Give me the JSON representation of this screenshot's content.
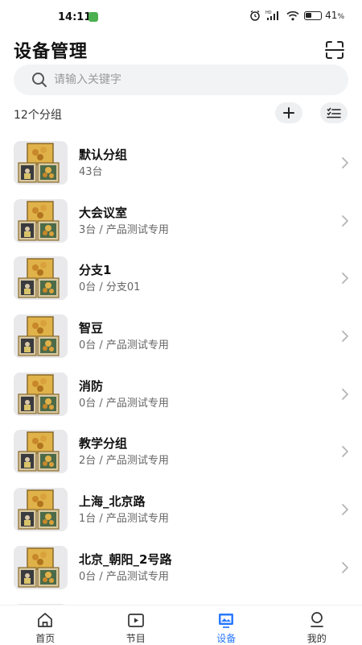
{
  "status_bar": {
    "time": "14:11",
    "battery_text": "41",
    "battery_unit": "%",
    "battery_level": 0.41,
    "network_label": "HD"
  },
  "header": {
    "title": "设备管理",
    "scan_icon": "scan-icon"
  },
  "search": {
    "placeholder": "请输入关键字",
    "value": ""
  },
  "groups_bar": {
    "count_text": "12个分组",
    "add_icon": "plus-icon",
    "sort_icon": "list-check-icon"
  },
  "groups": [
    {
      "name": "默认分组",
      "subtitle": "43台"
    },
    {
      "name": "大会议室",
      "subtitle": "3台 / 产品测试专用"
    },
    {
      "name": "分支1",
      "subtitle": "0台 / 分支01"
    },
    {
      "name": "智豆",
      "subtitle": "0台 / 产品测试专用"
    },
    {
      "name": "消防",
      "subtitle": "0台 / 产品测试专用"
    },
    {
      "name": "教学分组",
      "subtitle": "2台 / 产品测试专用"
    },
    {
      "name": "上海_北京路",
      "subtitle": "1台 / 产品测试专用"
    },
    {
      "name": "北京_朝阳_2号路",
      "subtitle": "0台 / 产品测试专用"
    }
  ],
  "bottom_nav": [
    {
      "label": "首页",
      "icon": "home-icon",
      "active": false
    },
    {
      "label": "节目",
      "icon": "play-icon",
      "active": false
    },
    {
      "label": "设备",
      "icon": "device-icon",
      "active": true
    },
    {
      "label": "我的",
      "icon": "profile-icon",
      "active": false
    }
  ],
  "colors": {
    "accent": "#2979ff",
    "search_bg": "#f2f3f5",
    "thumb_bg": "#e9e9eb"
  }
}
